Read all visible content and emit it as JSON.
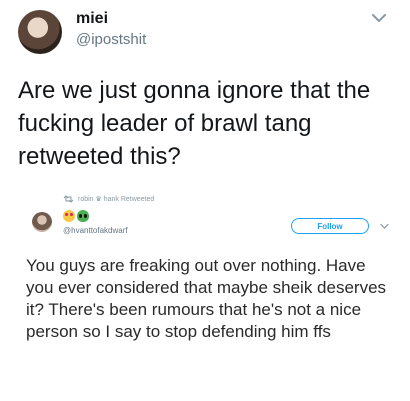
{
  "tweet": {
    "display_name": "miei",
    "handle": "@ipostshit",
    "text": "Are we just gonna ignore that the fucking leader of brawl tang retweeted this?",
    "avatar_icon": "profile-photo",
    "menu_icon": "chevron-down-icon"
  },
  "embedded": {
    "retweet_label": "robin ♛ hank Retweeted",
    "handle": "@hvanttofakdwarf",
    "emojis": [
      "heart-eyes-emoji",
      "alien-emoji"
    ],
    "follow_label": "Follow",
    "text": "You guys are freaking out over nothing. Have you ever considered that maybe sheik deserves it? There's been rumours that he's not a nice person so I say to stop defending him ffs",
    "accent_color": "#1da1f2"
  }
}
